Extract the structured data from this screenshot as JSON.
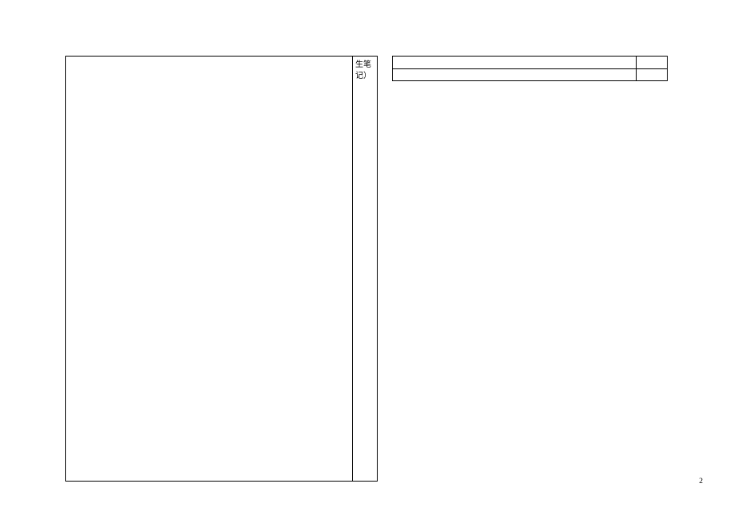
{
  "left_side_label": "生笔记）",
  "page_number": "2"
}
